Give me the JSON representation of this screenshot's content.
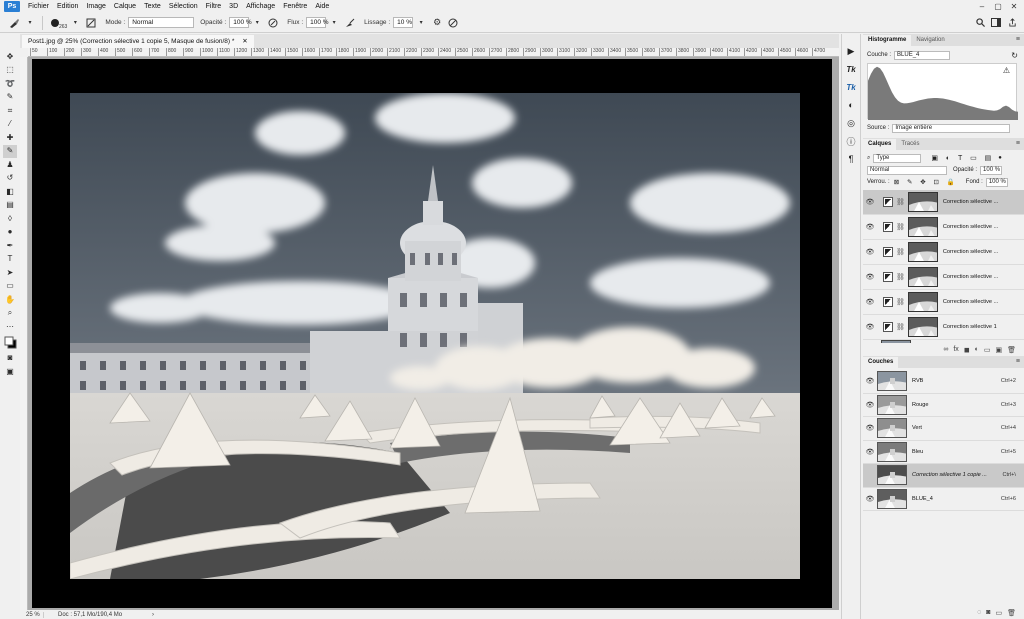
{
  "app": {
    "logo": "Ps"
  },
  "menu": [
    "Fichier",
    "Edition",
    "Image",
    "Calque",
    "Texte",
    "Sélection",
    "Filtre",
    "3D",
    "Affichage",
    "Fenêtre",
    "Aide"
  ],
  "window_controls": [
    "–",
    "▢",
    "✕"
  ],
  "options": {
    "brush_size": "263",
    "mode_label": "Mode :",
    "mode_value": "Normal",
    "opacity_label": "Opacité :",
    "opacity_value": "100 %",
    "flow_label": "Flux :",
    "flow_value": "100 %",
    "smoothing_label": "Lissage :",
    "smoothing_value": "10 %"
  },
  "document": {
    "tab_title": "Post1.jpg @ 25% (Correction sélective 1 copie 5, Masque de fusion/8) *",
    "ruler_ticks": [
      "50",
      "100",
      "200",
      "300",
      "400",
      "500",
      "600",
      "700",
      "800",
      "900",
      "1000",
      "1100",
      "1200",
      "1300",
      "1400",
      "1500",
      "1600",
      "1700",
      "1800",
      "1900",
      "2000",
      "2100",
      "2200",
      "2300",
      "2400",
      "2500",
      "2600",
      "2700",
      "2800",
      "2900",
      "3000",
      "3100",
      "3200",
      "3300",
      "3400",
      "3500",
      "3600",
      "3700",
      "3800",
      "3900",
      "4000",
      "4100",
      "4200",
      "4300",
      "4500",
      "4600",
      "4700"
    ]
  },
  "status": {
    "zoom": "25 %",
    "docsize": "Doc : 57,1 Mo/190,4 Mo",
    "arrow": "›"
  },
  "histogram": {
    "tabs": [
      "Histogramme",
      "Navigation"
    ],
    "channel_label": "Couche :",
    "channel_value": "BLUE_4",
    "source_label": "Source :",
    "source_value": "Image entière",
    "warning": "⚠"
  },
  "layers": {
    "tabs": [
      "Calques",
      "Tracés"
    ],
    "filter_value": "Type",
    "blend_mode": "Normal",
    "opacity_label": "Opacité :",
    "opacity_value": "100 %",
    "lock_label": "Verrou. :",
    "fill_label": "Fond :",
    "fill_value": "100 %",
    "items": [
      {
        "name": "Correction sélective ...",
        "selected": true
      },
      {
        "name": "Correction sélective ...",
        "selected": false
      },
      {
        "name": "Correction sélective ...",
        "selected": false
      },
      {
        "name": "Correction sélective ...",
        "selected": false
      },
      {
        "name": "Correction sélective ...",
        "selected": false
      },
      {
        "name": "Correction sélective 1",
        "selected": false
      }
    ],
    "footer_icons": [
      "∞",
      "fx",
      "◼",
      "◐",
      "▭",
      "▣",
      "🗑"
    ]
  },
  "channels": {
    "title": "Couches",
    "items": [
      {
        "name": "RVB",
        "shortcut": "Ctrl+2",
        "selected": false,
        "italic": false
      },
      {
        "name": "Rouge",
        "shortcut": "Ctrl+3",
        "selected": false,
        "italic": false
      },
      {
        "name": "Vert",
        "shortcut": "Ctrl+4",
        "selected": false,
        "italic": false
      },
      {
        "name": "Bleu",
        "shortcut": "Ctrl+5",
        "selected": false,
        "italic": false
      },
      {
        "name": "Correction sélective 1 copie ...",
        "shortcut": "Ctrl+\\",
        "selected": true,
        "italic": true
      },
      {
        "name": "BLUE_4",
        "shortcut": "Ctrl+6",
        "selected": false,
        "italic": false
      }
    ],
    "footer_icons": [
      "◌",
      "◙",
      "▭",
      "🗑"
    ]
  },
  "colors": {
    "sky": "#545d66",
    "cloud": "#e9ecef",
    "building": "#d3d5d8",
    "snow": "#efece7",
    "gravel": "#4d4d4d",
    "selected_row": "#c9c9c9"
  }
}
